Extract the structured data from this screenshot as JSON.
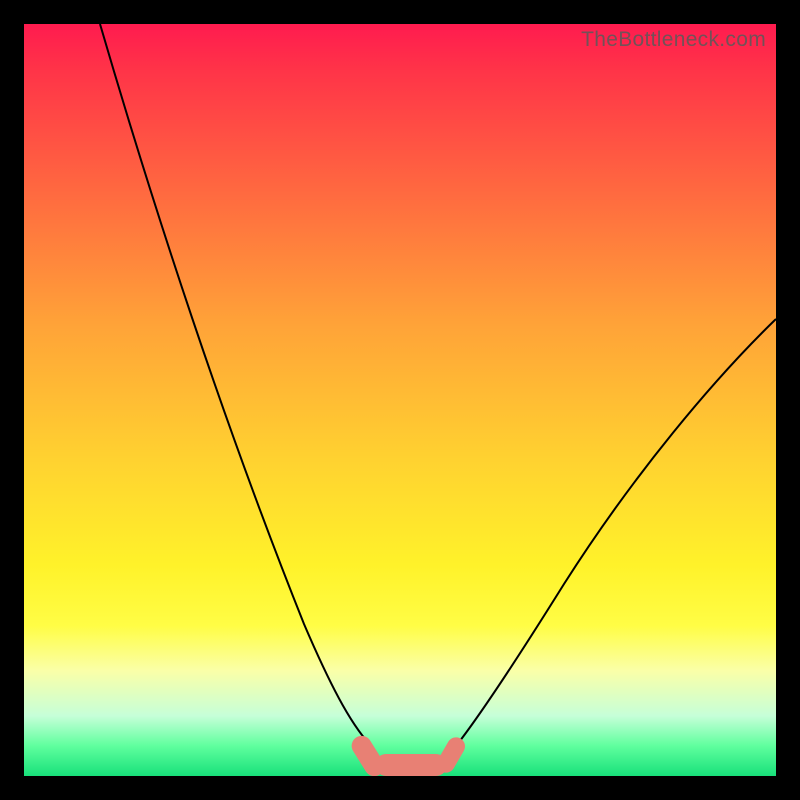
{
  "watermark": "TheBottleneck.com",
  "chart_data": {
    "type": "line",
    "title": "",
    "xlabel": "",
    "ylabel": "",
    "xlim": [
      0,
      100
    ],
    "ylim": [
      0,
      100
    ],
    "grid": false,
    "legend": false,
    "background": "heatmap-gradient",
    "gradient_stops": [
      {
        "pos": 0.0,
        "color": "#ff1b4f"
      },
      {
        "pos": 0.06,
        "color": "#ff3348"
      },
      {
        "pos": 0.22,
        "color": "#ff6840"
      },
      {
        "pos": 0.4,
        "color": "#ffa338"
      },
      {
        "pos": 0.58,
        "color": "#ffd230"
      },
      {
        "pos": 0.72,
        "color": "#fff22a"
      },
      {
        "pos": 0.8,
        "color": "#fffd45"
      },
      {
        "pos": 0.86,
        "color": "#faffa8"
      },
      {
        "pos": 0.92,
        "color": "#c6ffd8"
      },
      {
        "pos": 0.96,
        "color": "#5fff9e"
      },
      {
        "pos": 1.0,
        "color": "#18e07a"
      }
    ],
    "series": [
      {
        "name": "curve-left",
        "x": [
          10,
          15,
          20,
          25,
          30,
          35,
          40,
          44,
          48
        ],
        "y": [
          100,
          82,
          65,
          49,
          34,
          21,
          10,
          4,
          1
        ]
      },
      {
        "name": "curve-right",
        "x": [
          56,
          60,
          65,
          70,
          75,
          80,
          85,
          90,
          95,
          100
        ],
        "y": [
          1,
          3,
          8,
          14,
          21,
          29,
          37,
          45,
          53,
          61
        ]
      }
    ],
    "markers": [
      {
        "name": "blob-left",
        "x": 46,
        "y": 2,
        "shape": "capsule",
        "angle": -55,
        "size": 7,
        "color": "#e88074"
      },
      {
        "name": "blob-bottom",
        "x": 51,
        "y": 0.5,
        "shape": "capsule",
        "angle": 0,
        "size": 10,
        "color": "#e88074"
      },
      {
        "name": "blob-right",
        "x": 58,
        "y": 2,
        "shape": "capsule",
        "angle": 50,
        "size": 6,
        "color": "#e88074"
      }
    ]
  }
}
